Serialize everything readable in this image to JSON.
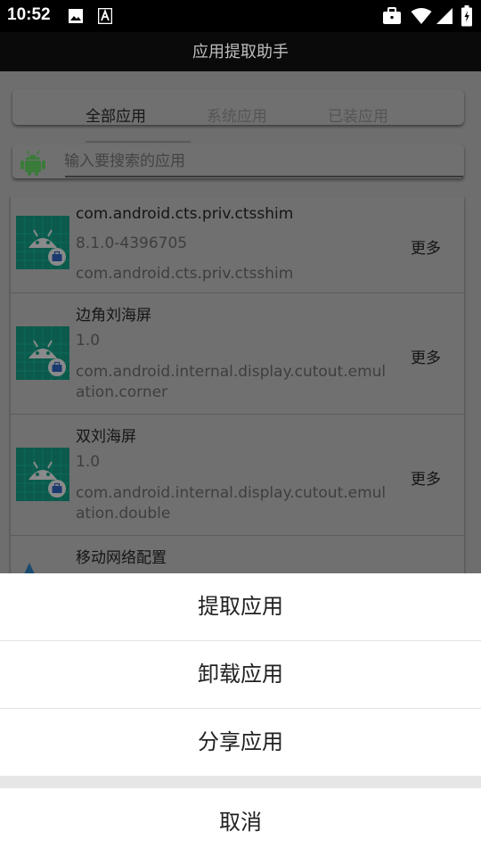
{
  "status_bar": {
    "time": "10:52"
  },
  "app_bar": {
    "title": "应用提取助手"
  },
  "tabs": [
    {
      "label": "全部应用",
      "active": true
    },
    {
      "label": "系统应用",
      "active": false
    },
    {
      "label": "已装应用",
      "active": false
    }
  ],
  "search": {
    "placeholder": "输入要搜索的应用"
  },
  "apps": [
    {
      "name": "com.android.cts.priv.ctsshim",
      "version": "8.1.0-4396705",
      "package": "com.android.cts.priv.ctsshim",
      "more_label": "更多"
    },
    {
      "name": "边角刘海屏",
      "version": "1.0",
      "package": "com.android.internal.display.cutout.emulation.corner",
      "more_label": "更多"
    },
    {
      "name": "双刘海屏",
      "version": "1.0",
      "package": "com.android.internal.display.cutout.emulation.double",
      "more_label": "更多"
    },
    {
      "name": "移动网络配置"
    }
  ],
  "sheet": {
    "extract_label": "提取应用",
    "uninstall_label": "卸载应用",
    "share_label": "分享应用",
    "cancel_label": "取消"
  },
  "colors": {
    "android_green": "#3ddc84",
    "icon_tile": "#0b6e5c",
    "overlay_gray": "#6e6e6e"
  }
}
